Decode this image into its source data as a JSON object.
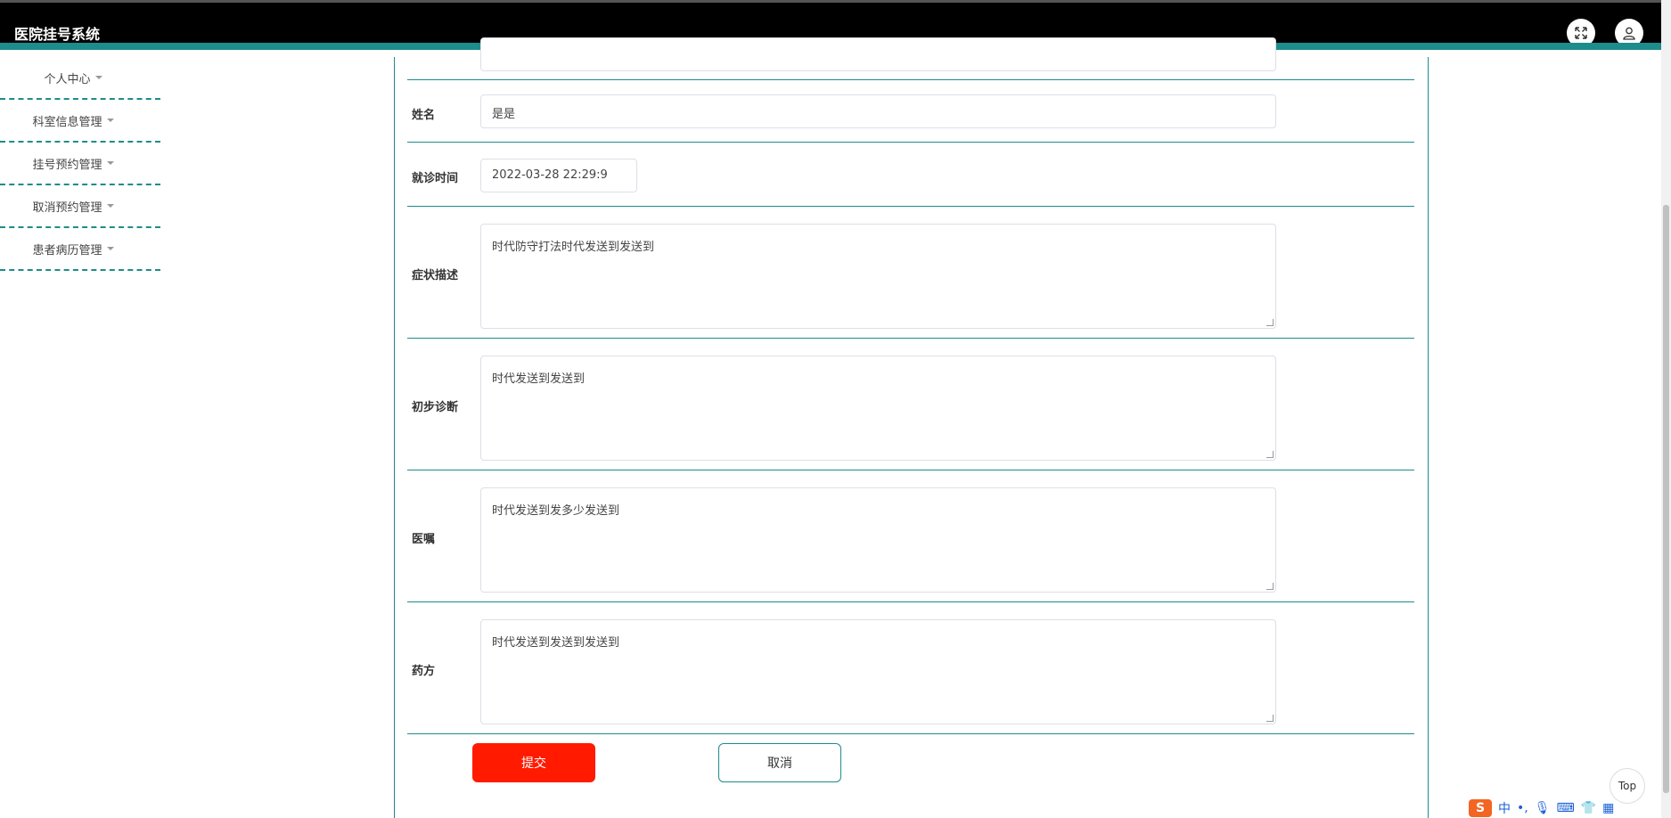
{
  "header": {
    "app_title": "医院挂号系统",
    "fullscreen_icon": "fullscreen-icon",
    "user_icon": "user-icon"
  },
  "sidebar": {
    "items": [
      {
        "label": "个人中心"
      },
      {
        "label": "科室信息管理"
      },
      {
        "label": "挂号预约管理"
      },
      {
        "label": "取消预约管理"
      },
      {
        "label": "患者病历管理"
      }
    ]
  },
  "form": {
    "fields": {
      "name": {
        "label": "姓名",
        "value": "是是"
      },
      "visit_time": {
        "label": "就诊时间",
        "value": "2022-03-28 22:29:9"
      },
      "symptoms": {
        "label": "症状描述",
        "value": "时代防守打法时代发送到发送到"
      },
      "diagnosis": {
        "label": "初步诊断",
        "value": "时代发送到发送到"
      },
      "advice": {
        "label": "医嘱",
        "value": "时代发送到发多少发送到"
      },
      "prescription": {
        "label": "药方",
        "value": "时代发送到发送到发送到"
      }
    },
    "submit_label": "提交",
    "cancel_label": "取消"
  },
  "widgets": {
    "top_label": "Top",
    "ime_label": "中"
  },
  "colors": {
    "accent": "#1e8c8c",
    "submit": "#ff1a00",
    "header_bg": "#000000"
  }
}
